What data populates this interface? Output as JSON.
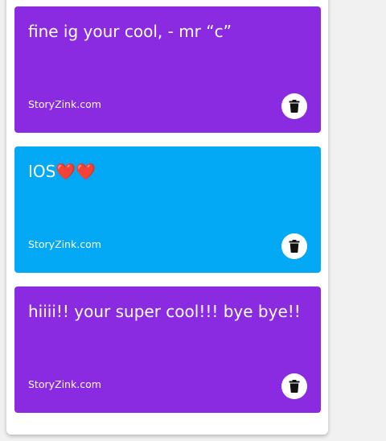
{
  "cards": [
    {
      "text": "fine ig your cool, - mr “c”",
      "footer": "StoryZink.com",
      "color": "#8a2be2",
      "delete_icon": "trash-icon"
    },
    {
      "text": "IOS❤️❤️",
      "footer": "StoryZink.com",
      "color": "#03a9f4",
      "delete_icon": "trash-icon"
    },
    {
      "text": "hiiii!! your super cool!!! bye bye!!",
      "footer": "StoryZink.com",
      "color": "#8a2be2",
      "delete_icon": "trash-icon"
    }
  ]
}
